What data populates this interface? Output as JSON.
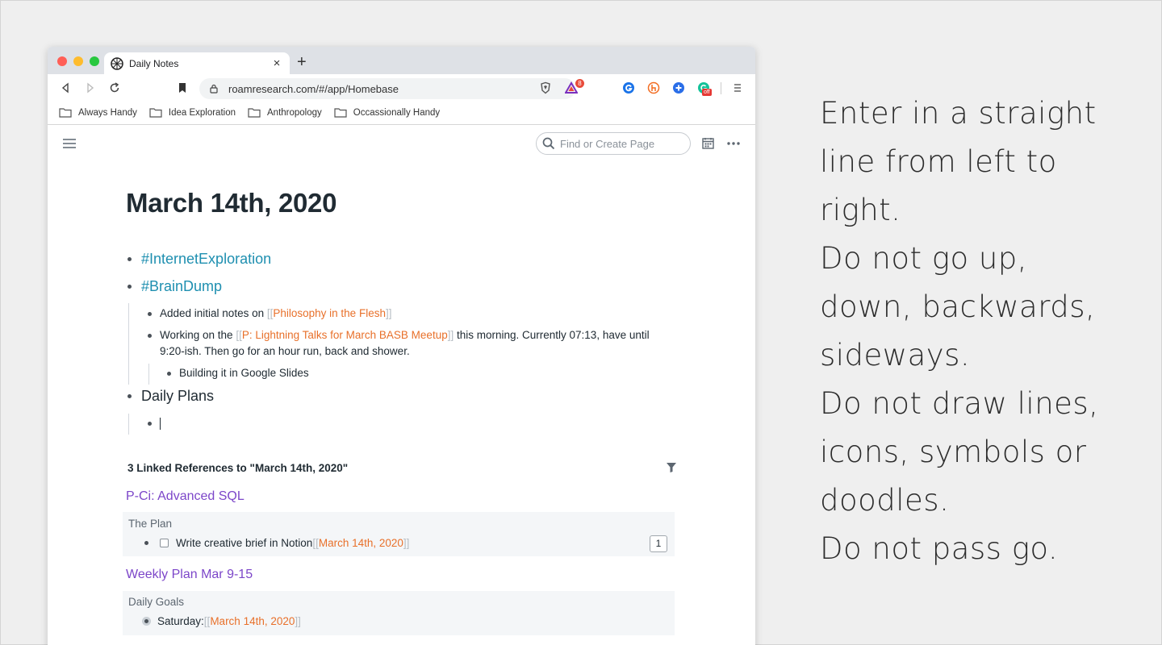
{
  "browser": {
    "tab_title": "Daily Notes",
    "tab_close": "×",
    "new_tab": "+",
    "url": "roamresearch.com/#/app/Homebase",
    "extension_badge": "8",
    "grammarly_badge": "off",
    "bookmarks": [
      "Always Handy",
      "Idea Exploration",
      "Anthropology",
      "Occassionally Handy"
    ]
  },
  "roam": {
    "search_placeholder": "Find or Create Page",
    "page_title": "March 14th, 2020",
    "blocks": {
      "internet_exploration": "#InternetExploration",
      "brain_dump": "#BrainDump",
      "note1_prefix": "Added initial notes on ",
      "note1_link": "Philosophy in the Flesh",
      "note2_prefix": "Working on the ",
      "note2_link": "P: Lightning Talks for March BASB Meetup",
      "note2_suffix": " this morning. Currently 07:13, have until",
      "note2_line2": "9:20-ish. Then go for an hour run, back and shower.",
      "note3": "Building it in Google Slides",
      "daily_plans": "Daily Plans"
    },
    "bracket_open": "[[",
    "bracket_close": "]]",
    "linked_refs": {
      "header": "3 Linked References to \"March 14th, 2020\"",
      "refs": [
        {
          "page": "P-Ci: Advanced SQL",
          "context": "The Plan",
          "text": "Write creative brief in Notion ",
          "link": "March 14th, 2020",
          "count": "1"
        },
        {
          "page": "Weekly Plan Mar 9-15",
          "context": "Daily Goals",
          "text": "Saturday: ",
          "link": "March 14th, 2020"
        }
      ]
    }
  },
  "instructions": [
    "Enter in a straight",
    "line from left to",
    "right.",
    "Do not go up,",
    "down, backwards,",
    "sideways.",
    "Do not draw lines,",
    "icons, symbols or",
    "doodles.",
    "Do not pass go."
  ]
}
